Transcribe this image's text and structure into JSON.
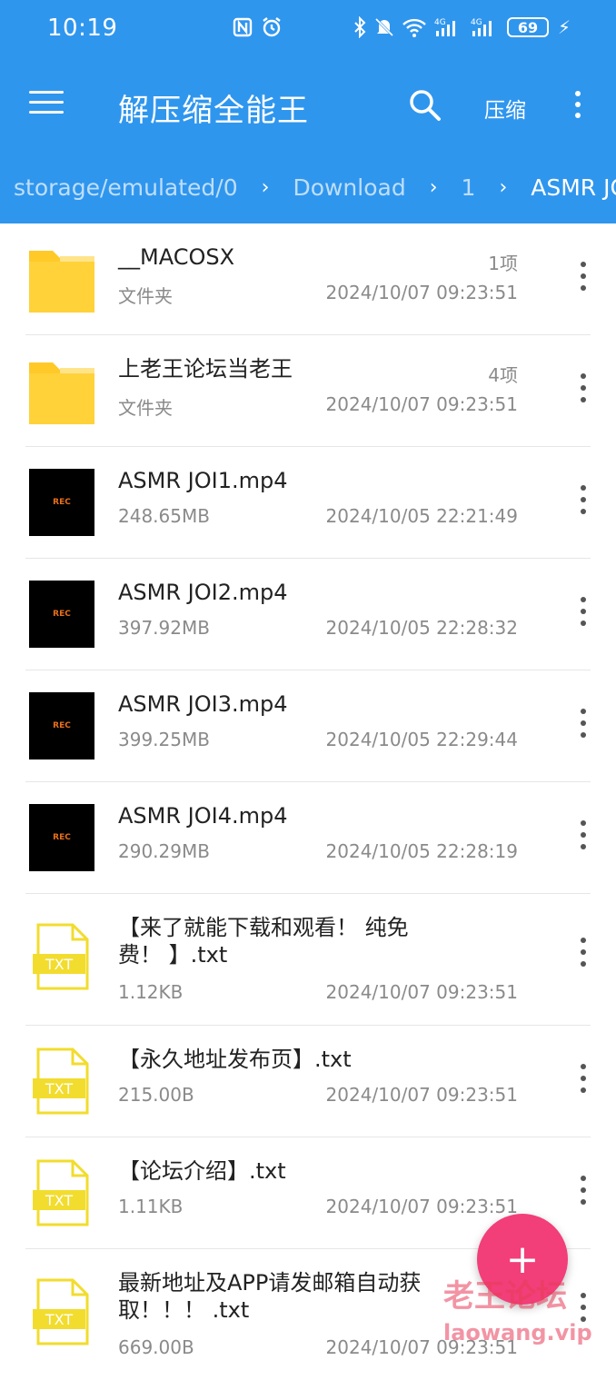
{
  "status_bar": {
    "time": "10:19",
    "battery": "69",
    "icons": [
      "nfc-icon",
      "alarm-icon",
      "bluetooth-icon",
      "mute-icon",
      "wifi-icon",
      "4g-signal-icon",
      "4g-signal-icon",
      "battery-icon",
      "charging-icon"
    ]
  },
  "app_bar": {
    "title": "解压缩全能王",
    "compress_label": "压缩",
    "icons": [
      "menu-icon",
      "search-icon",
      "more-vert-icon"
    ]
  },
  "breadcrumb": {
    "items": [
      "storage/emulated/0",
      "Download",
      "1",
      "ASMR JOL"
    ]
  },
  "files": [
    {
      "name": "__MACOSX",
      "sub": "文件夹",
      "count": "1项",
      "date": "2024/10/07 09:23:51",
      "icon": "folder-icon"
    },
    {
      "name": "上老王论坛当老王",
      "sub": "文件夹",
      "count": "4项",
      "date": "2024/10/07 09:23:51",
      "icon": "folder-icon"
    },
    {
      "name": "ASMR JOI1.mp4",
      "sub": "248.65MB",
      "date": "2024/10/05 22:21:49",
      "icon": "video-thumbnail",
      "thumb_label": "REC"
    },
    {
      "name": "ASMR JOI2.mp4",
      "sub": "397.92MB",
      "date": "2024/10/05 22:28:32",
      "icon": "video-thumbnail",
      "thumb_label": "REC"
    },
    {
      "name": "ASMR JOI3.mp4",
      "sub": "399.25MB",
      "date": "2024/10/05 22:29:44",
      "icon": "video-thumbnail",
      "thumb_label": "REC"
    },
    {
      "name": "ASMR JOI4.mp4",
      "sub": "290.29MB",
      "date": "2024/10/05 22:28:19",
      "icon": "video-thumbnail",
      "thumb_label": "REC"
    },
    {
      "name": "【来了就能下载和观看！ 纯免费！ 】.txt",
      "sub": "1.12KB",
      "date": "2024/10/07 09:23:51",
      "icon": "txt-file-icon",
      "thumb_label": "TXT"
    },
    {
      "name": "【永久地址发布页】.txt",
      "sub": "215.00B",
      "date": "2024/10/07 09:23:51",
      "icon": "txt-file-icon",
      "thumb_label": "TXT"
    },
    {
      "name": "【论坛介绍】.txt",
      "sub": "1.11KB",
      "date": "2024/10/07 09:23:51",
      "icon": "txt-file-icon",
      "thumb_label": "TXT"
    },
    {
      "name": "最新地址及APP请发邮箱自动获取！！！ .txt",
      "sub": "669.00B",
      "date": "2024/10/07 09:23:51",
      "icon": "txt-file-icon",
      "thumb_label": "TXT"
    }
  ],
  "fab": {
    "label": "+"
  },
  "watermark": {
    "line1": "老王论坛",
    "line2": "laowang.vip"
  },
  "colors": {
    "primary": "#2f96ee",
    "fab": "#f23e79",
    "folder": "#ffc928",
    "txt": "#f2dc2e"
  }
}
